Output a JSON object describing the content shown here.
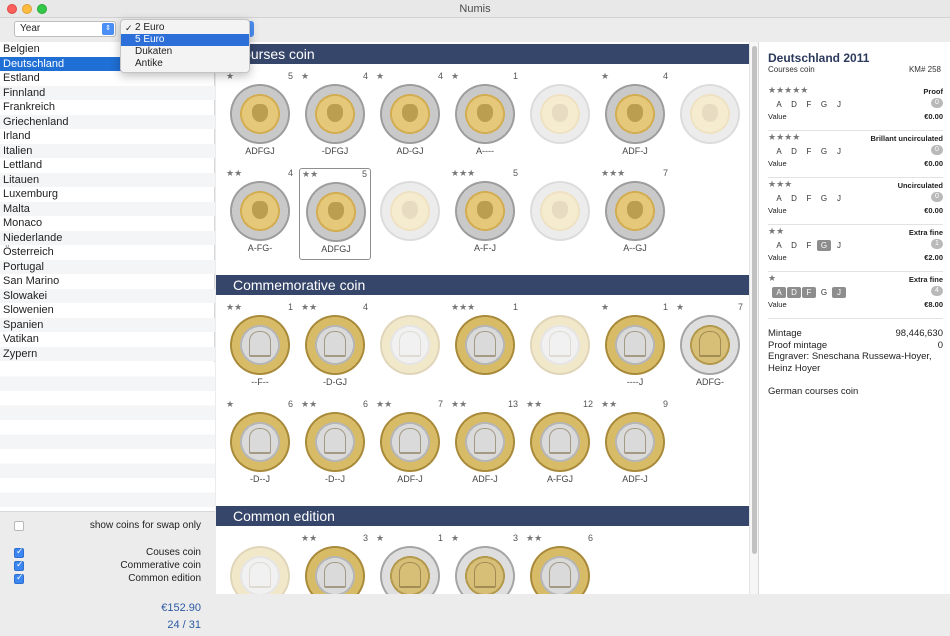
{
  "window": {
    "title": "Numis"
  },
  "toolbar": {
    "year_select": "Year",
    "dropdown": [
      "2 Euro",
      "5 Euro",
      "Dukaten",
      "Antike"
    ],
    "dropdown_checked": "2 Euro",
    "dropdown_highlighted": "5 Euro"
  },
  "sidebar": {
    "countries": [
      "Belgien",
      "Deutschland",
      "Estland",
      "Finnland",
      "Frankreich",
      "Griechenland",
      "Irland",
      "Italien",
      "Lettland",
      "Litauen",
      "Luxemburg",
      "Malta",
      "Monaco",
      "Niederlande",
      "Österreich",
      "Portugal",
      "San Marino",
      "Slowakei",
      "Slowenien",
      "Spanien",
      "Vatikan",
      "Zypern"
    ],
    "selected": "Deutschland",
    "swap_label": "show coins for swap only",
    "filters": [
      {
        "label": "Couses coin",
        "checked": true
      },
      {
        "label": "Commerative coin",
        "checked": true
      },
      {
        "label": "Common edition",
        "checked": true
      }
    ],
    "total": "€152.90",
    "count": "24 / 31"
  },
  "sections": [
    {
      "title": "Courses coin",
      "coins": [
        {
          "stars": "★",
          "count": "5",
          "code": "ADFGJ",
          "style": "bi",
          "faded": false
        },
        {
          "stars": "★",
          "count": "4",
          "code": "-DFGJ",
          "style": "bi",
          "faded": false
        },
        {
          "stars": "★",
          "count": "4",
          "code": "AD-GJ",
          "style": "bi",
          "faded": false
        },
        {
          "stars": "★",
          "count": "1",
          "code": "A----",
          "style": "bi",
          "faded": false
        },
        {
          "stars": "",
          "count": "",
          "code": "",
          "style": "bi",
          "faded": true
        },
        {
          "stars": "★",
          "count": "4",
          "code": "ADF-J",
          "style": "bi",
          "faded": false
        },
        {
          "stars": "",
          "count": "",
          "code": "",
          "style": "bi",
          "faded": true
        },
        {
          "stars": "★★",
          "count": "4",
          "code": "A-FG-",
          "style": "bi",
          "faded": false
        },
        {
          "stars": "★★",
          "count": "5",
          "code": "ADFGJ",
          "style": "bi",
          "faded": false,
          "selected": true
        },
        {
          "stars": "",
          "count": "",
          "code": "",
          "style": "bi",
          "faded": true
        },
        {
          "stars": "★★★",
          "count": "5",
          "code": "A-F-J",
          "style": "bi",
          "faded": false
        },
        {
          "stars": "",
          "count": "",
          "code": "",
          "style": "bi",
          "faded": true
        },
        {
          "stars": "★★★",
          "count": "7",
          "code": "A--GJ",
          "style": "bi",
          "faded": false
        }
      ]
    },
    {
      "title": "Commemorative coin",
      "coins": [
        {
          "stars": "★★",
          "count": "1",
          "code": "--F--",
          "style": "comm",
          "faded": false
        },
        {
          "stars": "★★",
          "count": "4",
          "code": "-D-GJ",
          "style": "comm",
          "faded": false
        },
        {
          "stars": "",
          "count": "",
          "code": "",
          "style": "comm",
          "faded": true
        },
        {
          "stars": "★★★",
          "count": "1",
          "code": "",
          "style": "comm",
          "faded": false
        },
        {
          "stars": "",
          "count": "",
          "code": "",
          "style": "comm",
          "faded": true
        },
        {
          "stars": "★",
          "count": "1",
          "code": "----J",
          "style": "comm",
          "faded": false
        },
        {
          "stars": "★",
          "count": "7",
          "code": "ADFG-",
          "style": "comm2",
          "faded": false
        },
        {
          "stars": "★",
          "count": "6",
          "code": "-D--J",
          "style": "comm",
          "faded": false
        },
        {
          "stars": "★★",
          "count": "6",
          "code": "-D--J",
          "style": "comm",
          "faded": false
        },
        {
          "stars": "★★",
          "count": "7",
          "code": "ADF-J",
          "style": "comm",
          "faded": false
        },
        {
          "stars": "★★",
          "count": "13",
          "code": "ADF-J",
          "style": "comm",
          "faded": false
        },
        {
          "stars": "★★",
          "count": "12",
          "code": "A-FGJ",
          "style": "comm",
          "faded": false
        },
        {
          "stars": "★★",
          "count": "9",
          "code": "ADF-J",
          "style": "comm",
          "faded": false
        }
      ]
    },
    {
      "title": "Common edition",
      "coins": [
        {
          "stars": "",
          "count": "",
          "code": "",
          "style": "comm",
          "faded": true
        },
        {
          "stars": "★★",
          "count": "3",
          "code": "",
          "style": "comm",
          "faded": false
        },
        {
          "stars": "★",
          "count": "1",
          "code": "",
          "style": "comm2",
          "faded": false
        },
        {
          "stars": "★",
          "count": "3",
          "code": "",
          "style": "comm2",
          "faded": false
        },
        {
          "stars": "★★",
          "count": "6",
          "code": "",
          "style": "comm",
          "faded": false
        }
      ]
    }
  ],
  "details": {
    "title": "Deutschland 2011",
    "subtitle": "Courses coin",
    "km": "KM# 258",
    "grades": [
      {
        "stars": "★★★★★",
        "name": "Proof",
        "mints": [
          "A",
          "D",
          "F",
          "G",
          "J"
        ],
        "on": [],
        "badge": "0",
        "value_label": "Value",
        "value": "€0.00"
      },
      {
        "stars": "★★★★",
        "name": "Brillant uncirculated",
        "mints": [
          "A",
          "D",
          "F",
          "G",
          "J"
        ],
        "on": [],
        "badge": "0",
        "value_label": "Value",
        "value": "€0.00"
      },
      {
        "stars": "★★★",
        "name": "Uncirculated",
        "mints": [
          "A",
          "D",
          "F",
          "G",
          "J"
        ],
        "on": [],
        "badge": "0",
        "value_label": "Value",
        "value": "€0.00"
      },
      {
        "stars": "★★",
        "name": "Extra fine",
        "mints": [
          "A",
          "D",
          "F",
          "G",
          "J"
        ],
        "on": [
          "G"
        ],
        "badge": "1",
        "value_label": "Value",
        "value": "€2.00"
      },
      {
        "stars": "★",
        "name": "Extra fine",
        "mints": [
          "A",
          "D",
          "F",
          "G",
          "J"
        ],
        "on": [
          "A",
          "D",
          "F",
          "J"
        ],
        "badge": "4",
        "value_label": "Value",
        "value": "€8.00"
      }
    ],
    "mintage_label": "Mintage",
    "mintage": "98,446,630",
    "proof_label": "Proof mintage",
    "proof": "0",
    "engraver": "Engraver: Sneschana Russewa-Hoyer, Heinz Hoyer",
    "note": "German courses coin"
  }
}
